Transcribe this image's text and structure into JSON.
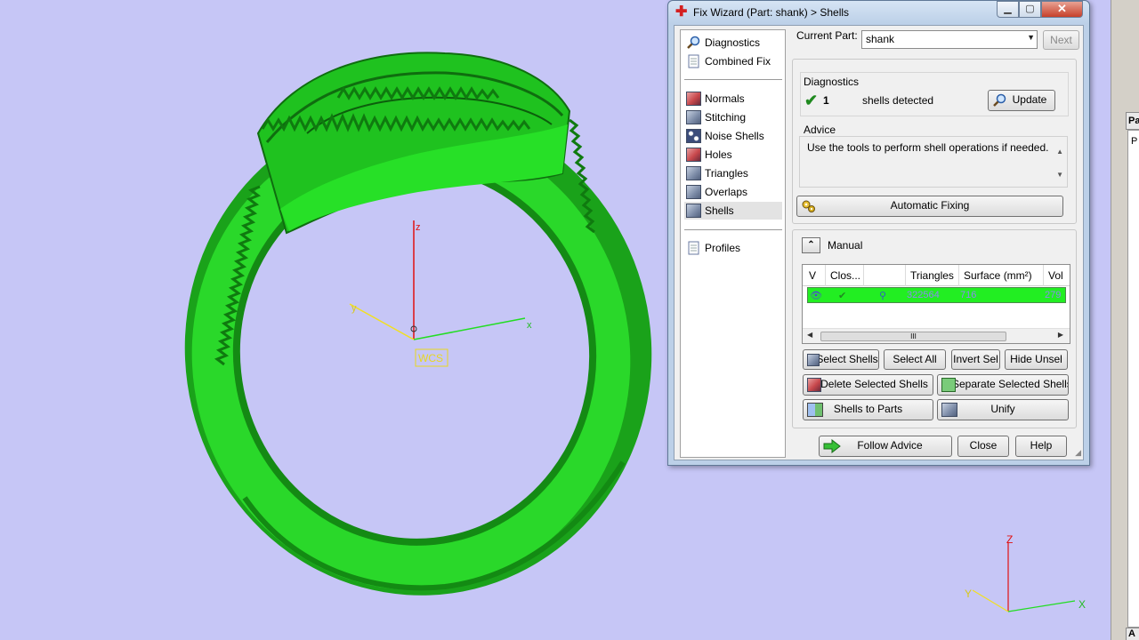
{
  "dialog": {
    "title": "Fix Wizard (Part: shank) > Shells",
    "close_glyph": "✕",
    "min_glyph": "▁",
    "max_glyph": "▢"
  },
  "nav": {
    "top_items": [
      {
        "label": "Diagnostics",
        "icon": "magnifier-icon"
      },
      {
        "label": "Combined Fix",
        "icon": "document-icon"
      }
    ],
    "fix_items": [
      {
        "label": "Normals",
        "icon": "normals-cube-icon"
      },
      {
        "label": "Stitching",
        "icon": "stitching-cube-icon"
      },
      {
        "label": "Noise Shells",
        "icon": "noise-shells-cube-icon"
      },
      {
        "label": "Holes",
        "icon": "holes-cube-icon"
      },
      {
        "label": "Triangles",
        "icon": "triangles-cube-icon"
      },
      {
        "label": "Overlaps",
        "icon": "overlaps-cube-icon"
      },
      {
        "label": "Shells",
        "icon": "shells-cube-icon",
        "active": true
      }
    ],
    "bottom_items": [
      {
        "label": "Profiles",
        "icon": "document-icon"
      }
    ]
  },
  "current_part": {
    "label": "Current Part:",
    "value": "shank",
    "next_label": "Next"
  },
  "diagnostics": {
    "heading": "Diagnostics",
    "count": "1",
    "text": "shells detected",
    "update_label": "Update"
  },
  "advice": {
    "heading": "Advice",
    "text": "Use the tools to perform shell operations if needed.",
    "automatic_fixing_label": "Automatic Fixing"
  },
  "manual": {
    "heading": "Manual",
    "collapse_glyph": "⌃",
    "columns": [
      "V",
      "Clos...",
      "",
      "Triangles",
      "Surface (mm²)",
      "Vol"
    ],
    "rows": [
      {
        "triangles": "322564",
        "surface": "716",
        "volume": "279"
      }
    ],
    "row_color": "#22ee22",
    "scroll_thumb_glyph": "III"
  },
  "buttons": {
    "select_shells": "Select Shells",
    "select_all": "Select All",
    "invert_sel": "Invert Sel",
    "hide_unsel": "Hide Unsel",
    "delete_selected": "Delete Selected Shells",
    "separate_selected": "Separate Selected Shells",
    "shells_to_parts": "Shells to Parts",
    "unify": "Unify",
    "follow_advice": "Follow Advice",
    "close": "Close",
    "help": "Help"
  },
  "viewport": {
    "axis_z": "z",
    "axis_y": "y",
    "axis_x": "x",
    "wcs_label": "WCS",
    "mini_z": "Z",
    "mini_y": "Y",
    "mini_x": "X",
    "background": "#c6c6f6",
    "model_color": "#22cc22"
  },
  "side_panel": {
    "tab": "Pa",
    "panel_letter": "P",
    "bottom_tab": "A"
  }
}
